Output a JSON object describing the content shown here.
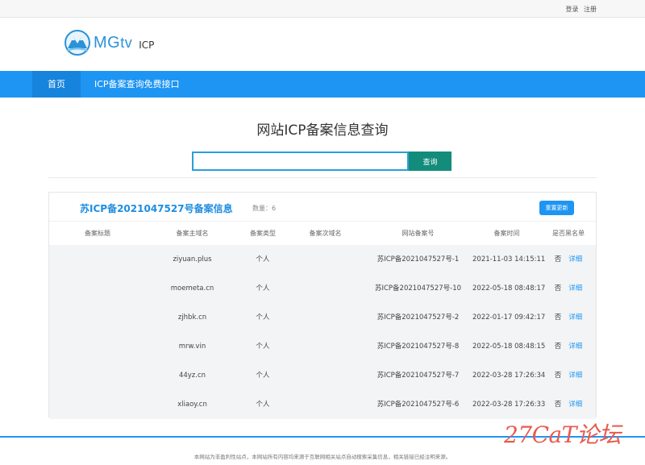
{
  "topbar": {
    "login": "登录",
    "register": "注册"
  },
  "logo": {
    "brand": "MG",
    "brand_tv": "tv",
    "sub": "ICP"
  },
  "nav": {
    "home": "首页",
    "api": "ICP备案查询免费接口"
  },
  "page_title": "网站ICP备案信息查询",
  "search": {
    "value": "",
    "button": "查询"
  },
  "panel": {
    "title": "苏ICP备2021047527号备案信息",
    "count": "数量：6",
    "refresh": "重置更新",
    "headers": [
      "备案标题",
      "备案主域名",
      "备案类型",
      "备案次域名",
      "网站备案号",
      "备案时间",
      "是否黑名单"
    ],
    "rows": [
      {
        "title": "",
        "domain": "ziyuan.plus",
        "type": "个人",
        "sub": "",
        "icp": "苏ICP备2021047527号-1",
        "time": "2021-11-03 14:15:11",
        "black": "否",
        "detail": "详细"
      },
      {
        "title": "",
        "domain": "moemeta.cn",
        "type": "个人",
        "sub": "",
        "icp": "苏ICP备2021047527号-10",
        "time": "2022-05-18 08:48:17",
        "black": "否",
        "detail": "详细"
      },
      {
        "title": "",
        "domain": "zjhbk.cn",
        "type": "个人",
        "sub": "",
        "icp": "苏ICP备2021047527号-2",
        "time": "2022-01-17 09:42:17",
        "black": "否",
        "detail": "详细"
      },
      {
        "title": "",
        "domain": "mrw.vin",
        "type": "个人",
        "sub": "",
        "icp": "苏ICP备2021047527号-8",
        "time": "2022-05-18 08:48:15",
        "black": "否",
        "detail": "详细"
      },
      {
        "title": "",
        "domain": "44yz.cn",
        "type": "个人",
        "sub": "",
        "icp": "苏ICP备2021047527号-7",
        "time": "2022-03-28 17:26:34",
        "black": "否",
        "detail": "详细"
      },
      {
        "title": "",
        "domain": "xliaoy.cn",
        "type": "个人",
        "sub": "",
        "icp": "苏ICP备2021047527号-6",
        "time": "2022-03-28 17:26:33",
        "black": "否",
        "detail": "详细"
      }
    ]
  },
  "footer": "本网站为非盈利性站点，本网站所有内容均来源于互联网相关站点自动搜索采集信息，相关链接已经注明来源。",
  "watermark": "27CaT论坛",
  "colors": {
    "accent": "#1e95f3",
    "search_button": "#148c7b",
    "title_blue": "#1e8de0"
  },
  "icons": {
    "logo": "mountain-logo-icon"
  }
}
